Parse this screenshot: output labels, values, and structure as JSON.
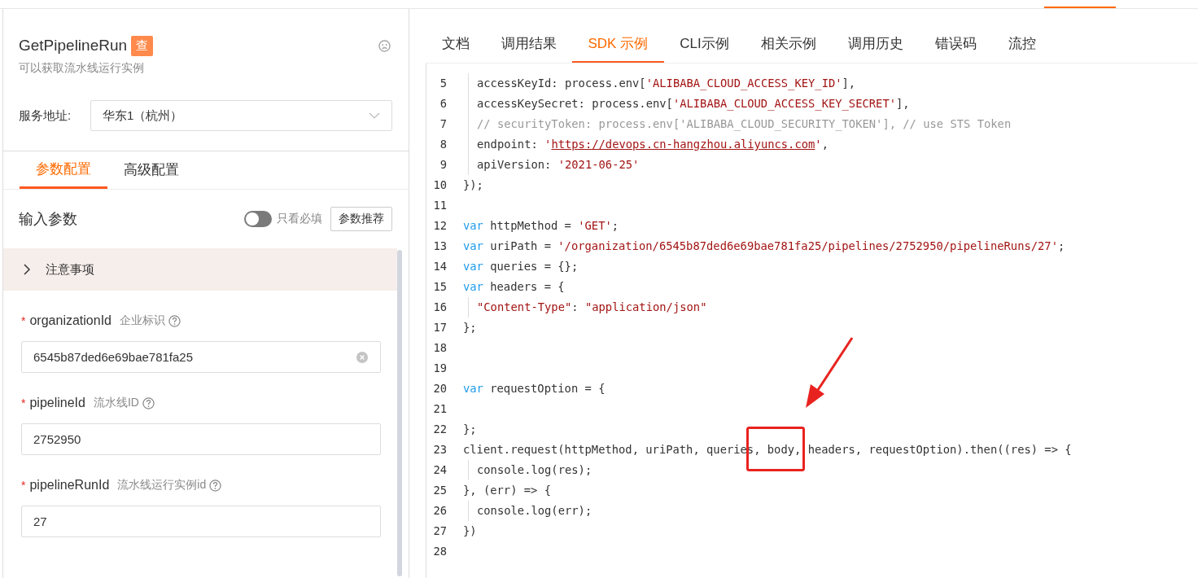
{
  "api": {
    "name": "GetPipelineRun",
    "badge": "查",
    "description": "可以获取流水线运行实例"
  },
  "service": {
    "label": "服务地址:",
    "value": "华东1（杭州）"
  },
  "config_tabs": [
    {
      "label": "参数配置",
      "selected": true
    },
    {
      "label": "高级配置",
      "selected": false
    }
  ],
  "params_header": {
    "title": "输入参数",
    "toggle": {
      "label": "只看必填",
      "on": false
    },
    "button": "参数推荐"
  },
  "notes": {
    "label": "注意事项",
    "expanded": false
  },
  "fields": [
    {
      "name": "organizationId",
      "description": "企业标识",
      "required_mark": "*",
      "value": "6545b87ded6e69bae781fa25",
      "clearable": true
    },
    {
      "name": "pipelineId",
      "description": "流水线ID",
      "required_mark": "*",
      "value": "2752950",
      "clearable": false
    },
    {
      "name": "pipelineRunId",
      "description": "流水线运行实例id",
      "required_mark": "*",
      "value": "27",
      "clearable": false
    }
  ],
  "tabs": [
    {
      "label": "文档",
      "selected": false
    },
    {
      "label": "调用结果",
      "selected": false
    },
    {
      "label": "SDK 示例",
      "selected": true
    },
    {
      "label": "CLI示例",
      "selected": false
    },
    {
      "label": "相关示例",
      "selected": false
    },
    {
      "label": "调用历史",
      "selected": false
    },
    {
      "label": "错误码",
      "selected": false
    },
    {
      "label": "流控",
      "selected": false
    }
  ],
  "code": {
    "lines": [
      {
        "number": "5",
        "indented": true,
        "tokens": [
          {
            "kind": "plain",
            "text": "accessKeyId: process.env["
          },
          {
            "kind": "string",
            "text": "'ALIBABA_CLOUD_ACCESS_KEY_ID'"
          },
          {
            "kind": "plain",
            "text": "],"
          }
        ]
      },
      {
        "number": "6",
        "indented": true,
        "tokens": [
          {
            "kind": "plain",
            "text": "accessKeySecret: process.env["
          },
          {
            "kind": "string",
            "text": "'ALIBABA_CLOUD_ACCESS_KEY_SECRET'"
          },
          {
            "kind": "plain",
            "text": "],"
          }
        ]
      },
      {
        "number": "7",
        "indented": true,
        "tokens": [
          {
            "kind": "comment",
            "text": "// securityToken: process.env['ALIBABA_CLOUD_SECURITY_TOKEN'], // use STS Token"
          }
        ]
      },
      {
        "number": "8",
        "indented": true,
        "tokens": [
          {
            "kind": "plain",
            "text": "endpoint: "
          },
          {
            "kind": "string",
            "text": "'"
          },
          {
            "kind": "link",
            "text": "https://devops.cn-hangzhou.aliyuncs.com"
          },
          {
            "kind": "string",
            "text": "'"
          },
          {
            "kind": "plain",
            "text": ","
          }
        ]
      },
      {
        "number": "9",
        "indented": true,
        "tokens": [
          {
            "kind": "plain",
            "text": "apiVersion: "
          },
          {
            "kind": "string",
            "text": "'2021-06-25'"
          }
        ]
      },
      {
        "number": "10",
        "indented": false,
        "tokens": [
          {
            "kind": "plain",
            "text": "});"
          }
        ]
      },
      {
        "number": "11"
      },
      {
        "number": "12",
        "indented": false,
        "tokens": [
          {
            "kind": "keyword",
            "text": "var"
          },
          {
            "kind": "plain",
            "text": " httpMethod = "
          },
          {
            "kind": "string",
            "text": "'GET'"
          },
          {
            "kind": "plain",
            "text": ";"
          }
        ]
      },
      {
        "number": "13",
        "indented": false,
        "tokens": [
          {
            "kind": "keyword",
            "text": "var"
          },
          {
            "kind": "plain",
            "text": " uriPath = "
          },
          {
            "kind": "string",
            "text": "'/organization/6545b87ded6e69bae781fa25/pipelines/2752950/pipelineRuns/27'"
          },
          {
            "kind": "plain",
            "text": ";"
          }
        ]
      },
      {
        "number": "14",
        "indented": false,
        "tokens": [
          {
            "kind": "keyword",
            "text": "var"
          },
          {
            "kind": "plain",
            "text": " queries = {};"
          }
        ]
      },
      {
        "number": "15",
        "indented": false,
        "tokens": [
          {
            "kind": "keyword",
            "text": "var"
          },
          {
            "kind": "plain",
            "text": " headers = {"
          }
        ]
      },
      {
        "number": "16",
        "indented": true,
        "tokens": [
          {
            "kind": "string",
            "text": "\"Content-Type\""
          },
          {
            "kind": "plain",
            "text": ": "
          },
          {
            "kind": "string",
            "text": "\"application/json\""
          }
        ]
      },
      {
        "number": "17",
        "indented": false,
        "tokens": [
          {
            "kind": "plain",
            "text": "};"
          }
        ]
      },
      {
        "number": "18"
      },
      {
        "number": "19"
      },
      {
        "number": "20",
        "indented": false,
        "tokens": [
          {
            "kind": "keyword",
            "text": "var"
          },
          {
            "kind": "plain",
            "text": " requestOption = {"
          }
        ]
      },
      {
        "number": "21"
      },
      {
        "number": "22",
        "indented": false,
        "tokens": [
          {
            "kind": "plain",
            "text": "};"
          }
        ]
      },
      {
        "number": "23",
        "indented": false,
        "tokens": [
          {
            "kind": "plain",
            "text": "client.request(httpMethod, uriPath, queries, body, headers, requestOption).then((res) => {"
          }
        ]
      },
      {
        "number": "24",
        "indented": true,
        "tokens": [
          {
            "kind": "plain",
            "text": "console.log(res);"
          }
        ]
      },
      {
        "number": "25",
        "indented": false,
        "tokens": [
          {
            "kind": "plain",
            "text": "}, (err) => {"
          }
        ]
      },
      {
        "number": "26",
        "indented": true,
        "tokens": [
          {
            "kind": "plain",
            "text": "console.log(err);"
          }
        ]
      },
      {
        "number": "27",
        "indented": false,
        "tokens": [
          {
            "kind": "plain",
            "text": "})"
          }
        ]
      },
      {
        "number": "28"
      }
    ]
  },
  "highlight_box": {
    "color": "#e8231f"
  },
  "arrow": {
    "color": "#e8231f"
  }
}
